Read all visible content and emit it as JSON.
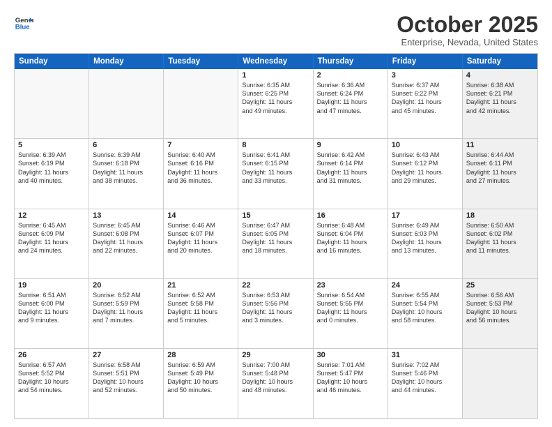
{
  "header": {
    "logo_line1": "General",
    "logo_line2": "Blue",
    "month": "October 2025",
    "location": "Enterprise, Nevada, United States"
  },
  "weekdays": [
    "Sunday",
    "Monday",
    "Tuesday",
    "Wednesday",
    "Thursday",
    "Friday",
    "Saturday"
  ],
  "rows": [
    [
      {
        "day": "",
        "text": "",
        "empty": true
      },
      {
        "day": "",
        "text": "",
        "empty": true
      },
      {
        "day": "",
        "text": "",
        "empty": true
      },
      {
        "day": "1",
        "text": "Sunrise: 6:35 AM\nSunset: 6:25 PM\nDaylight: 11 hours\nand 49 minutes.",
        "empty": false
      },
      {
        "day": "2",
        "text": "Sunrise: 6:36 AM\nSunset: 6:24 PM\nDaylight: 11 hours\nand 47 minutes.",
        "empty": false
      },
      {
        "day": "3",
        "text": "Sunrise: 6:37 AM\nSunset: 6:22 PM\nDaylight: 11 hours\nand 45 minutes.",
        "empty": false
      },
      {
        "day": "4",
        "text": "Sunrise: 6:38 AM\nSunset: 6:21 PM\nDaylight: 11 hours\nand 42 minutes.",
        "empty": false,
        "shaded": true
      }
    ],
    [
      {
        "day": "5",
        "text": "Sunrise: 6:39 AM\nSunset: 6:19 PM\nDaylight: 11 hours\nand 40 minutes.",
        "empty": false
      },
      {
        "day": "6",
        "text": "Sunrise: 6:39 AM\nSunset: 6:18 PM\nDaylight: 11 hours\nand 38 minutes.",
        "empty": false
      },
      {
        "day": "7",
        "text": "Sunrise: 6:40 AM\nSunset: 6:16 PM\nDaylight: 11 hours\nand 36 minutes.",
        "empty": false
      },
      {
        "day": "8",
        "text": "Sunrise: 6:41 AM\nSunset: 6:15 PM\nDaylight: 11 hours\nand 33 minutes.",
        "empty": false
      },
      {
        "day": "9",
        "text": "Sunrise: 6:42 AM\nSunset: 6:14 PM\nDaylight: 11 hours\nand 31 minutes.",
        "empty": false
      },
      {
        "day": "10",
        "text": "Sunrise: 6:43 AM\nSunset: 6:12 PM\nDaylight: 11 hours\nand 29 minutes.",
        "empty": false
      },
      {
        "day": "11",
        "text": "Sunrise: 6:44 AM\nSunset: 6:11 PM\nDaylight: 11 hours\nand 27 minutes.",
        "empty": false,
        "shaded": true
      }
    ],
    [
      {
        "day": "12",
        "text": "Sunrise: 6:45 AM\nSunset: 6:09 PM\nDaylight: 11 hours\nand 24 minutes.",
        "empty": false
      },
      {
        "day": "13",
        "text": "Sunrise: 6:45 AM\nSunset: 6:08 PM\nDaylight: 11 hours\nand 22 minutes.",
        "empty": false
      },
      {
        "day": "14",
        "text": "Sunrise: 6:46 AM\nSunset: 6:07 PM\nDaylight: 11 hours\nand 20 minutes.",
        "empty": false
      },
      {
        "day": "15",
        "text": "Sunrise: 6:47 AM\nSunset: 6:05 PM\nDaylight: 11 hours\nand 18 minutes.",
        "empty": false
      },
      {
        "day": "16",
        "text": "Sunrise: 6:48 AM\nSunset: 6:04 PM\nDaylight: 11 hours\nand 16 minutes.",
        "empty": false
      },
      {
        "day": "17",
        "text": "Sunrise: 6:49 AM\nSunset: 6:03 PM\nDaylight: 11 hours\nand 13 minutes.",
        "empty": false
      },
      {
        "day": "18",
        "text": "Sunrise: 6:50 AM\nSunset: 6:02 PM\nDaylight: 11 hours\nand 11 minutes.",
        "empty": false,
        "shaded": true
      }
    ],
    [
      {
        "day": "19",
        "text": "Sunrise: 6:51 AM\nSunset: 6:00 PM\nDaylight: 11 hours\nand 9 minutes.",
        "empty": false
      },
      {
        "day": "20",
        "text": "Sunrise: 6:52 AM\nSunset: 5:59 PM\nDaylight: 11 hours\nand 7 minutes.",
        "empty": false
      },
      {
        "day": "21",
        "text": "Sunrise: 6:52 AM\nSunset: 5:58 PM\nDaylight: 11 hours\nand 5 minutes.",
        "empty": false
      },
      {
        "day": "22",
        "text": "Sunrise: 6:53 AM\nSunset: 5:56 PM\nDaylight: 11 hours\nand 3 minutes.",
        "empty": false
      },
      {
        "day": "23",
        "text": "Sunrise: 6:54 AM\nSunset: 5:55 PM\nDaylight: 11 hours\nand 0 minutes.",
        "empty": false
      },
      {
        "day": "24",
        "text": "Sunrise: 6:55 AM\nSunset: 5:54 PM\nDaylight: 10 hours\nand 58 minutes.",
        "empty": false
      },
      {
        "day": "25",
        "text": "Sunrise: 6:56 AM\nSunset: 5:53 PM\nDaylight: 10 hours\nand 56 minutes.",
        "empty": false,
        "shaded": true
      }
    ],
    [
      {
        "day": "26",
        "text": "Sunrise: 6:57 AM\nSunset: 5:52 PM\nDaylight: 10 hours\nand 54 minutes.",
        "empty": false
      },
      {
        "day": "27",
        "text": "Sunrise: 6:58 AM\nSunset: 5:51 PM\nDaylight: 10 hours\nand 52 minutes.",
        "empty": false
      },
      {
        "day": "28",
        "text": "Sunrise: 6:59 AM\nSunset: 5:49 PM\nDaylight: 10 hours\nand 50 minutes.",
        "empty": false
      },
      {
        "day": "29",
        "text": "Sunrise: 7:00 AM\nSunset: 5:48 PM\nDaylight: 10 hours\nand 48 minutes.",
        "empty": false
      },
      {
        "day": "30",
        "text": "Sunrise: 7:01 AM\nSunset: 5:47 PM\nDaylight: 10 hours\nand 46 minutes.",
        "empty": false
      },
      {
        "day": "31",
        "text": "Sunrise: 7:02 AM\nSunset: 5:46 PM\nDaylight: 10 hours\nand 44 minutes.",
        "empty": false
      },
      {
        "day": "",
        "text": "",
        "empty": true,
        "shaded": true
      }
    ]
  ]
}
